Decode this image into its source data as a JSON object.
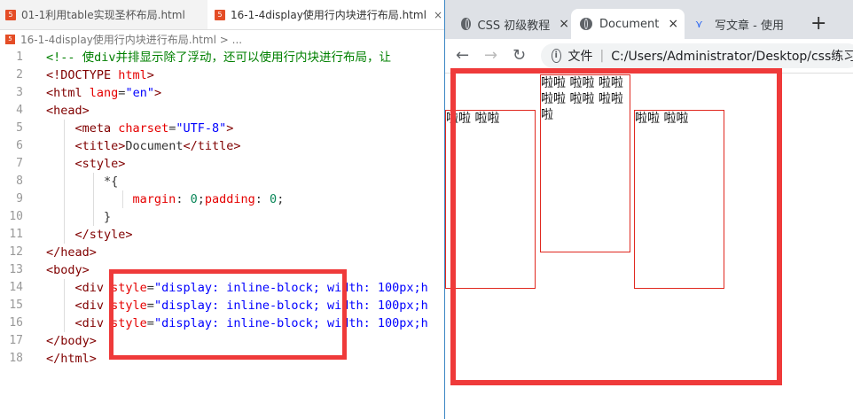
{
  "editor": {
    "tabs": [
      {
        "label": "01-1利用table实现圣杯布局.html",
        "icon": "html5-icon"
      },
      {
        "label": "16-1-4display使用行内块进行布局.html",
        "icon": "html5-icon",
        "close": "×"
      }
    ],
    "breadcrumb": "16-1-4display使用行内块进行布局.html > ...",
    "line_numbers": [
      "1",
      "2",
      "3",
      "4",
      "5",
      "6",
      "7",
      "8",
      "9",
      "10",
      "11",
      "12",
      "13",
      "14",
      "15",
      "16",
      "17",
      "18"
    ],
    "lines": {
      "l1": "<!-- 使div并排显示除了浮动，还可以使用行内块进行布局，让",
      "l2a": "<!DOCTYPE ",
      "l2b": "html",
      "l2c": ">",
      "l3a": "<html ",
      "l3b": "lang",
      "l3c": "=",
      "l3d": "\"en\"",
      "l3e": ">",
      "l4": "<head>",
      "l5a": "<meta ",
      "l5b": "charset",
      "l5c": "=",
      "l5d": "\"UTF-8\"",
      "l5e": ">",
      "l6a": "<title>",
      "l6b": "Document",
      "l6c": "</title>",
      "l7": "<style>",
      "l8": "*{",
      "l9a": "margin",
      "l9b": ": ",
      "l9c": "0",
      "l9d": ";",
      "l9e": "padding",
      "l9f": ": ",
      "l9g": "0",
      "l9h": ";",
      "l10": "}",
      "l11": "</style>",
      "l12": "</head>",
      "l13": "<body>",
      "l14a": "<div ",
      "l14b": "style",
      "l14c": "=",
      "l14d": "\"display: inline-block; width: 100px;h",
      "l15a": "<div ",
      "l15b": "style",
      "l15c": "=",
      "l15d": "\"display: inline-block; width: 100px;h",
      "l16a": "<div ",
      "l16b": "style",
      "l16c": "=",
      "l16d": "\"display: inline-block; width: 100px;h",
      "l17": "</body>",
      "l18": "</html>"
    }
  },
  "browser": {
    "tabs": [
      {
        "label": "CSS 初级教程",
        "close": "×"
      },
      {
        "label": "Document",
        "close": "×"
      },
      {
        "label": "写文章 - 使用"
      }
    ],
    "new_tab": "+",
    "back": "←",
    "forward": "→",
    "reload": "↻",
    "info": "i",
    "file_label": "文件",
    "separator": "|",
    "url": "C:/Users/Administrator/Desktop/css练习/",
    "boxes": [
      {
        "text": "啦啦 啦啦"
      },
      {
        "text": "啦啦 啦啦 啦啦 啦啦 啦啦 啦啦 啦"
      },
      {
        "text": "啦啦 啦啦"
      }
    ]
  }
}
